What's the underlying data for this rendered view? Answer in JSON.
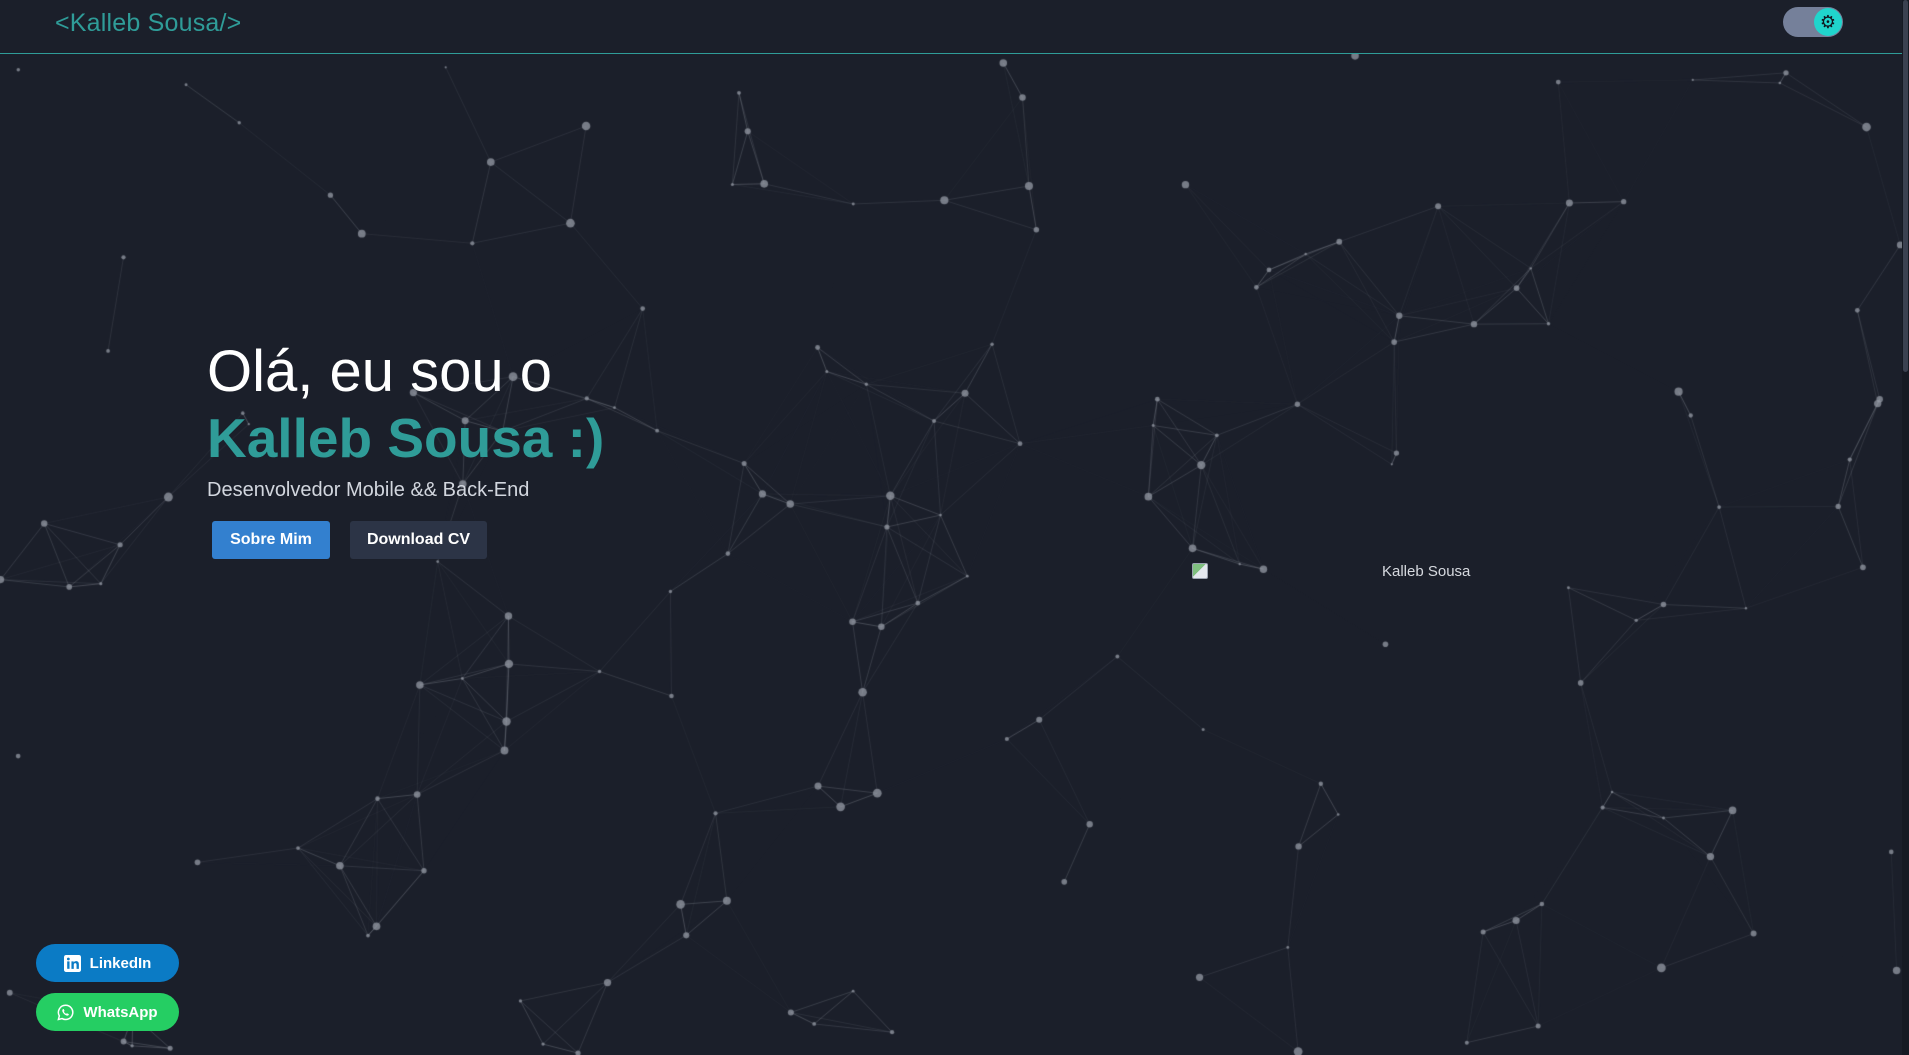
{
  "navbar": {
    "brand": "<Kalleb Sousa/>",
    "theme_toggle_icon": "gear-icon"
  },
  "hero": {
    "greeting": "Olá, eu sou o",
    "name": "Kalleb Sousa :)",
    "subtitle": "Desenvolvedor Mobile && Back-End",
    "about_button": "Sobre Mim",
    "cv_button": "Download CV"
  },
  "avatar": {
    "alt_text": "Kalleb Sousa"
  },
  "social": {
    "linkedin": "LinkedIn",
    "whatsapp": "WhatsApp"
  },
  "colors": {
    "background": "#1b1f2a",
    "accent": "#2f9c98",
    "primary_button": "#3380cf",
    "secondary_button": "#2c3446",
    "linkedin": "#0b7bc5",
    "whatsapp": "#25ce63"
  }
}
